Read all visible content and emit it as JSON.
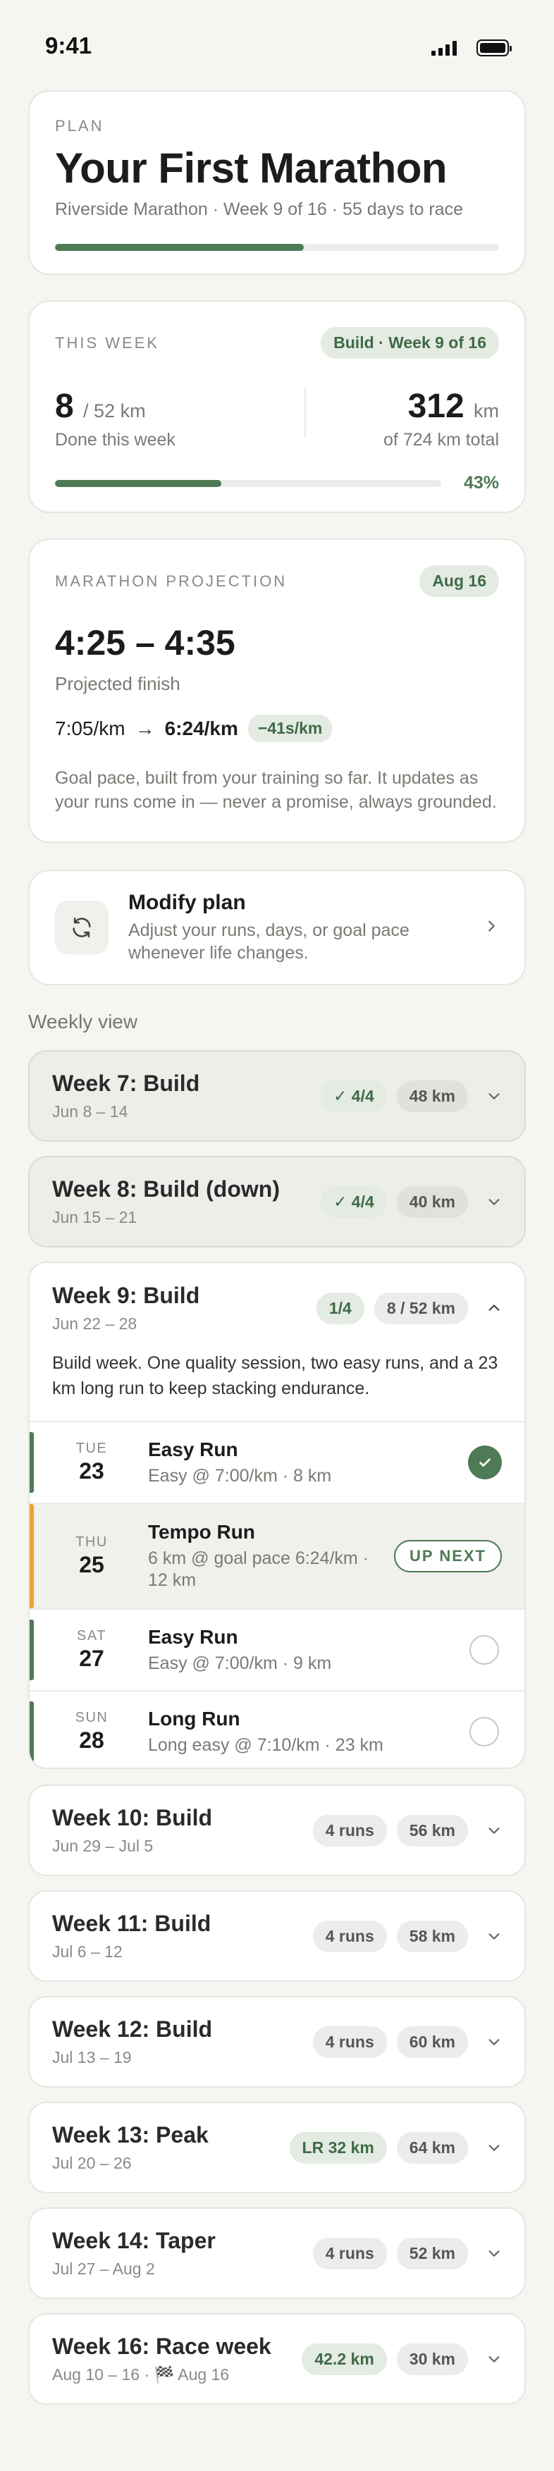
{
  "status": {
    "time": "9:41"
  },
  "plan": {
    "eyebrow": "PLAN",
    "title": "Your First Marathon",
    "subtitle": "Riverside Marathon · Week 9 of 16 · 55 days to race",
    "progress": 0.56
  },
  "this_week": {
    "eyebrow": "THIS WEEK",
    "badge": "Build · Week 9 of 16",
    "done_value": "8",
    "done_total": "/ 52 km",
    "done_label": "Done this week",
    "total_value": "312",
    "total_unit": "km",
    "total_label": "of 724 km total",
    "progress": 0.43,
    "percent": "43%"
  },
  "projection": {
    "eyebrow": "MARATHON PROJECTION",
    "date_badge": "Aug 16",
    "range": "4:25 – 4:35",
    "label": "Projected finish",
    "pace_from": "7:05/km",
    "arrow": "→",
    "pace_to": "6:24/km",
    "delta": "−41s/km",
    "note": "Goal pace, built from your training so far. It updates as your runs come in — never a promise, always grounded."
  },
  "modify": {
    "title": "Modify plan",
    "desc": "Adjust your runs, days, or goal pace whenever life changes.",
    "icon": "refresh-icon"
  },
  "weekly_label": "Weekly view",
  "weeks_before": [
    {
      "title": "Week 7: Build",
      "dates": "Jun 8 – 14",
      "badge": "✓ 4/4",
      "km": "48 km"
    },
    {
      "title": "Week 8: Build (down)",
      "dates": "Jun 15 – 21",
      "badge": "✓ 4/4",
      "km": "40 km"
    }
  ],
  "week9": {
    "title": "Week 9: Build",
    "dates": "Jun 22 – 28",
    "badge": "1/4",
    "km": "8 / 52 km",
    "desc": "Build week. One quality session, two easy runs, and a 23 km long run to keep stacking endurance.",
    "runs": [
      {
        "dow": "TUE",
        "day": "23",
        "name": "Easy Run",
        "detail": "Easy @ 7:00/km · 8 km",
        "state": "done"
      },
      {
        "dow": "THU",
        "day": "25",
        "name": "Tempo Run",
        "detail": "6 km @ goal pace 6:24/km · 12 km",
        "state": "next",
        "next_label": "UP NEXT"
      },
      {
        "dow": "SAT",
        "day": "27",
        "name": "Easy Run",
        "detail": "Easy @ 7:00/km · 9 km",
        "state": "todo"
      },
      {
        "dow": "SUN",
        "day": "28",
        "name": "Long Run",
        "detail": "Long easy @ 7:10/km · 23 km",
        "state": "todo"
      }
    ]
  },
  "weeks_after": [
    {
      "title": "Week 10: Build",
      "dates": "Jun 29 – Jul 5",
      "badge": "4 runs",
      "km": "56 km"
    },
    {
      "title": "Week 11: Build",
      "dates": "Jul 6 – 12",
      "badge": "4 runs",
      "km": "58 km"
    },
    {
      "title": "Week 12: Build",
      "dates": "Jul 13 – 19",
      "badge": "4 runs",
      "km": "60 km"
    },
    {
      "title": "Week 13: Peak",
      "dates": "Jul 20 – 26",
      "badge": "LR 32 km",
      "km": "64 km",
      "badge_green": true
    },
    {
      "title": "Week 14: Taper",
      "dates": "Jul 27 – Aug 2",
      "badge": "4 runs",
      "km": "52 km"
    },
    {
      "title": "Week 16: Race week",
      "dates": "Aug 10 – 16 · 🏁 Aug 16",
      "badge": "42.2 km",
      "km": "30 km",
      "badge_green": true
    }
  ]
}
